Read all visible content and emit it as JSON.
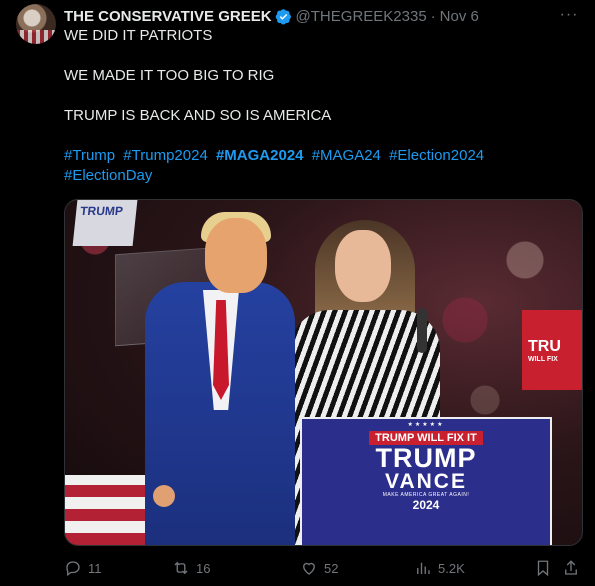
{
  "tweet": {
    "display_name": "THE CONSERVATIVE GREEK",
    "handle": "@THEGREEK2335",
    "separator": "·",
    "date": "Nov 6",
    "more": "···",
    "lines": [
      "WE DID IT PATRIOTS",
      "WE MADE IT TOO BIG TO RIG",
      "TRUMP IS BACK AND SO IS AMERICA"
    ],
    "hashtags": [
      "#Trump",
      "#Trump2024",
      "#MAGA2024",
      "#MAGA24",
      "#Election2024",
      "#ElectionDay"
    ],
    "verified_color": "#1d9bf0",
    "link_color": "#1d9bf0"
  },
  "image": {
    "podium_top": "TRUMP WILL FIX IT",
    "podium_line1": "TRUMP",
    "podium_line2": "VANCE",
    "podium_tagline": "MAKE AMERICA GREAT AGAIN!",
    "podium_year": "2024",
    "stars": "★★★★★",
    "crowd_sign_top": "TRUMP",
    "crowd_sign_right": "TRU",
    "crowd_sign_right_small": "WILL FIX"
  },
  "actions": {
    "replies": "11",
    "reposts": "16",
    "likes": "52",
    "views": "5.2K"
  }
}
